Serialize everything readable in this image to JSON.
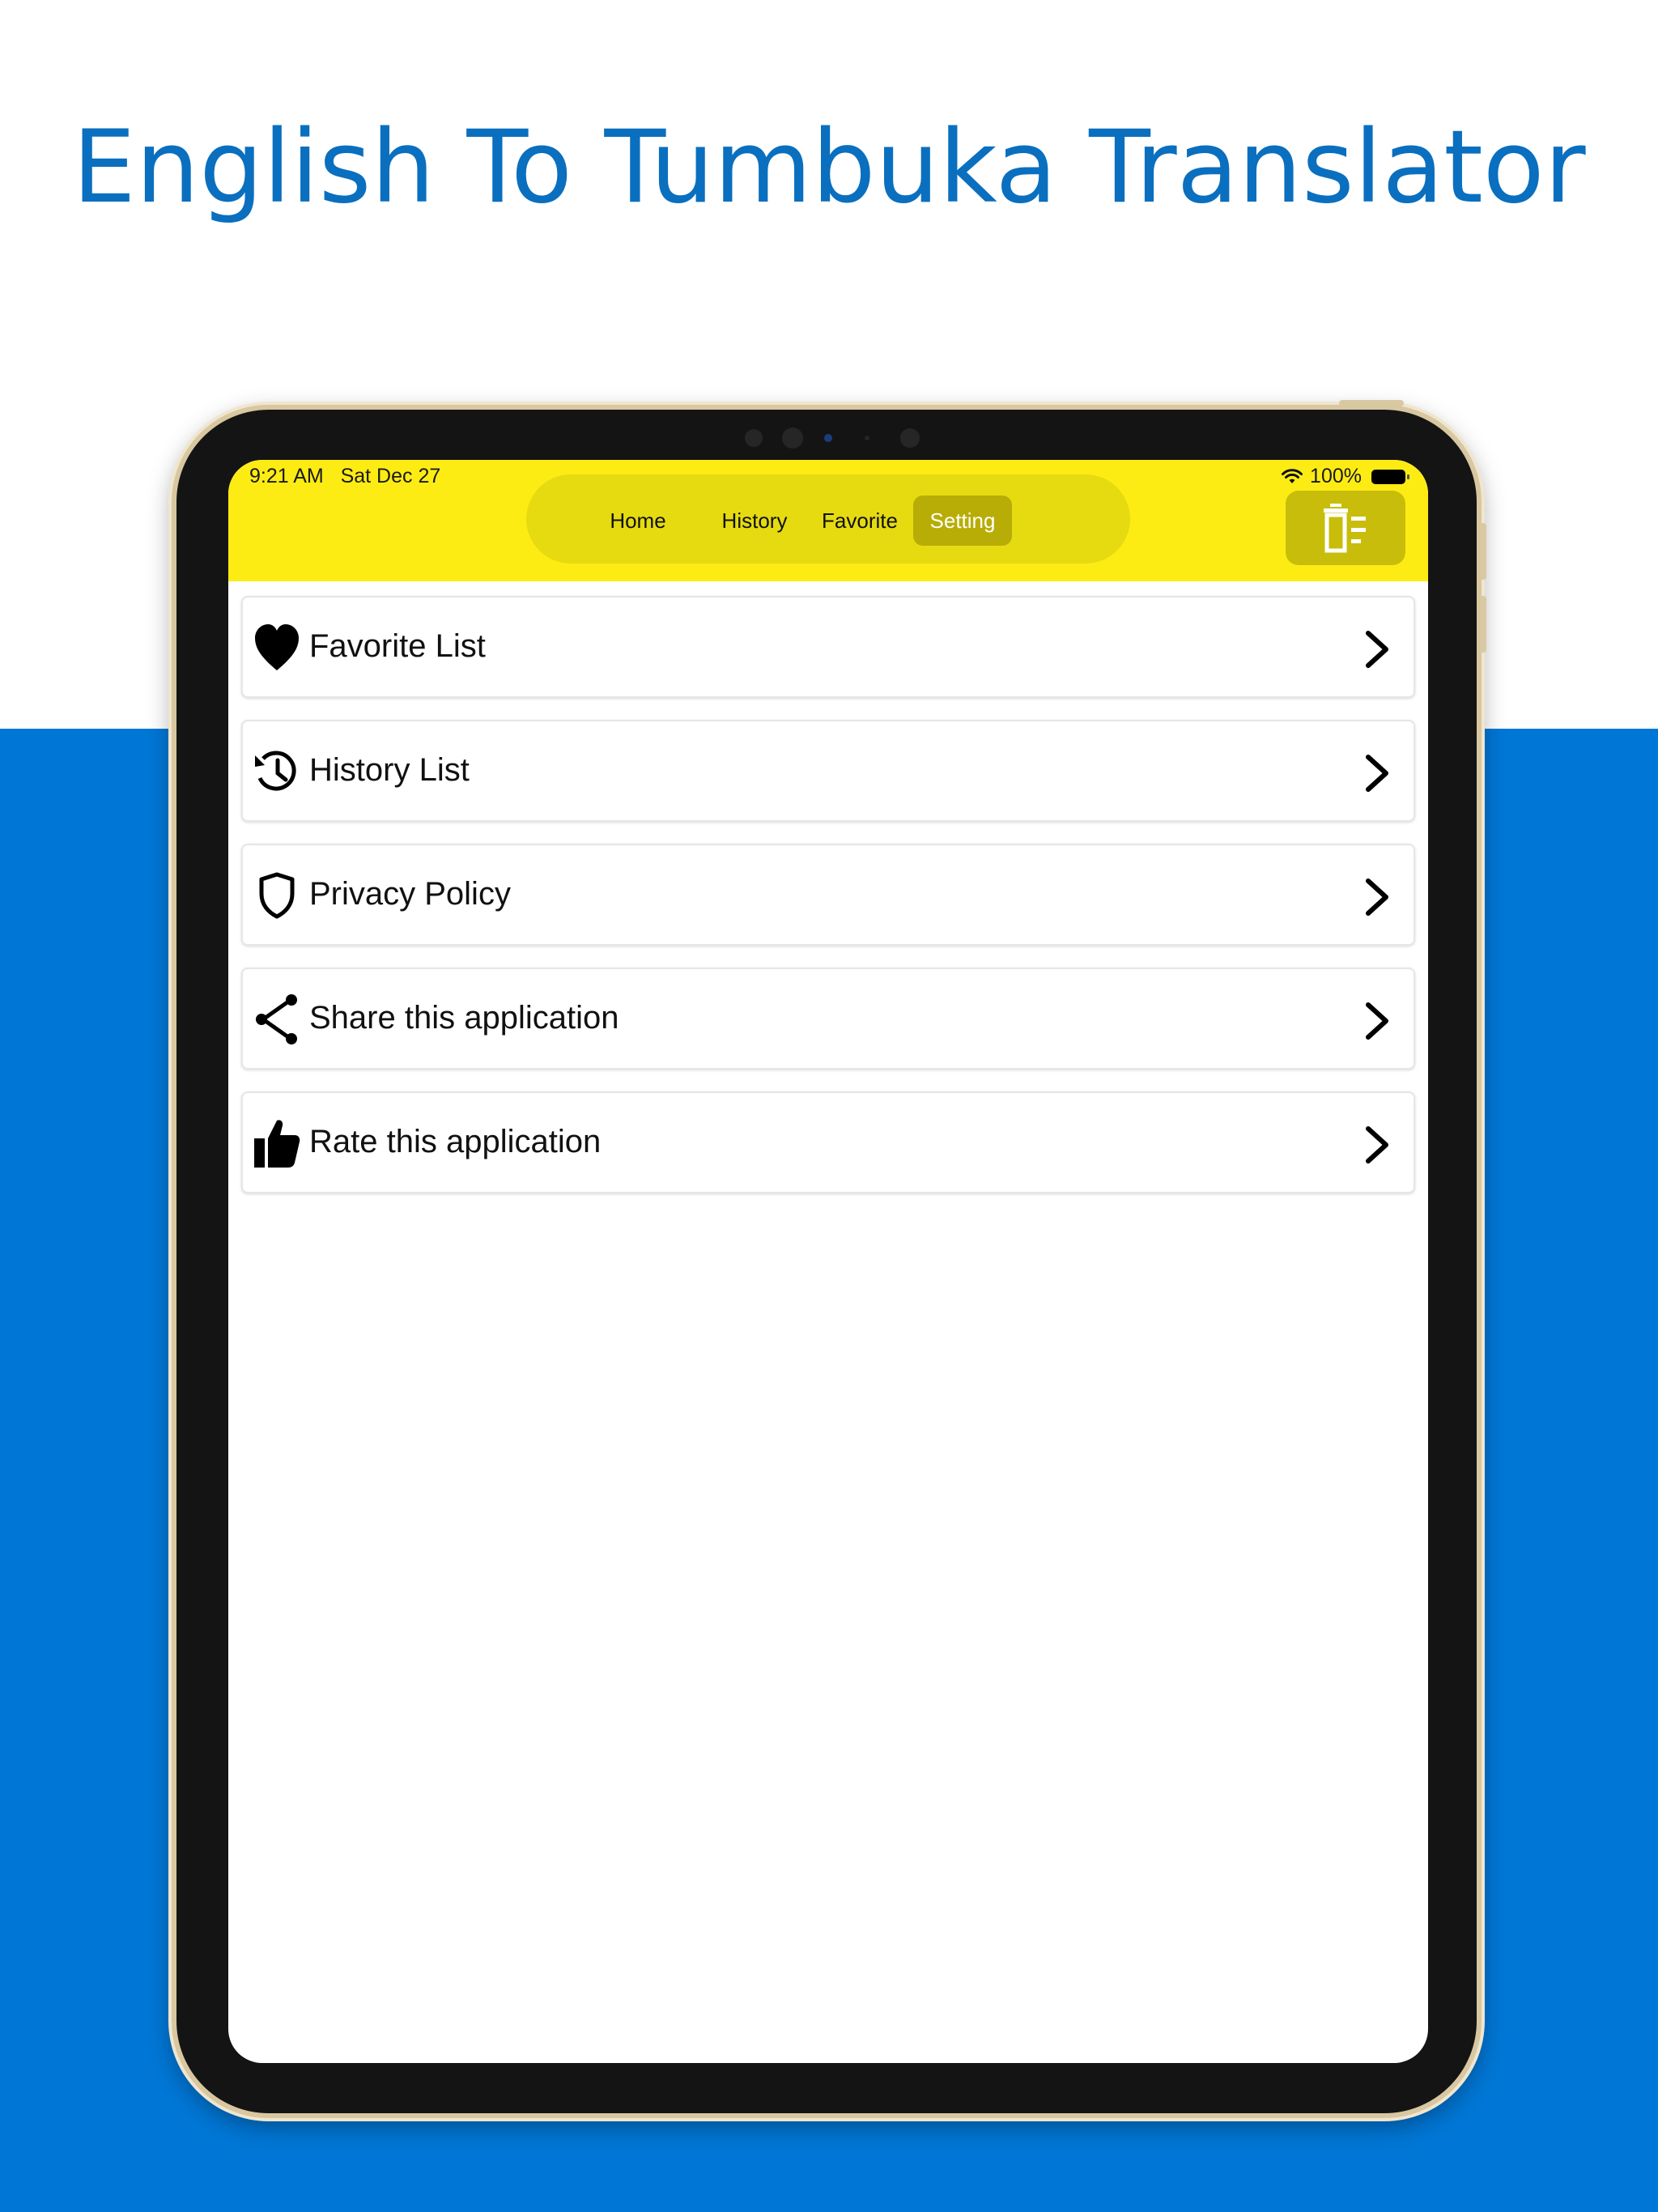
{
  "headline": "English To Tumbuka Translator",
  "colors": {
    "headline": "#0a6fbf",
    "band": "#0077d6",
    "topbar": "#fdec14",
    "tab_active": "#b8ad06"
  },
  "status_bar": {
    "time": "9:21 AM",
    "date": "Sat Dec 27",
    "battery": "100%"
  },
  "tabs": [
    {
      "label": "Home",
      "active": false
    },
    {
      "label": "History",
      "active": false
    },
    {
      "label": "Favorite",
      "active": false
    },
    {
      "label": "Setting",
      "active": true
    }
  ],
  "toolbar": {
    "delete_icon": "delete-icon"
  },
  "menu": [
    {
      "label": "Favorite List",
      "icon": "heart-icon"
    },
    {
      "label": "History List",
      "icon": "history-icon"
    },
    {
      "label": "Privacy Policy",
      "icon": "shield-icon"
    },
    {
      "label": "Share this application",
      "icon": "share-icon"
    },
    {
      "label": "Rate this application",
      "icon": "thumbs-up-icon"
    }
  ]
}
